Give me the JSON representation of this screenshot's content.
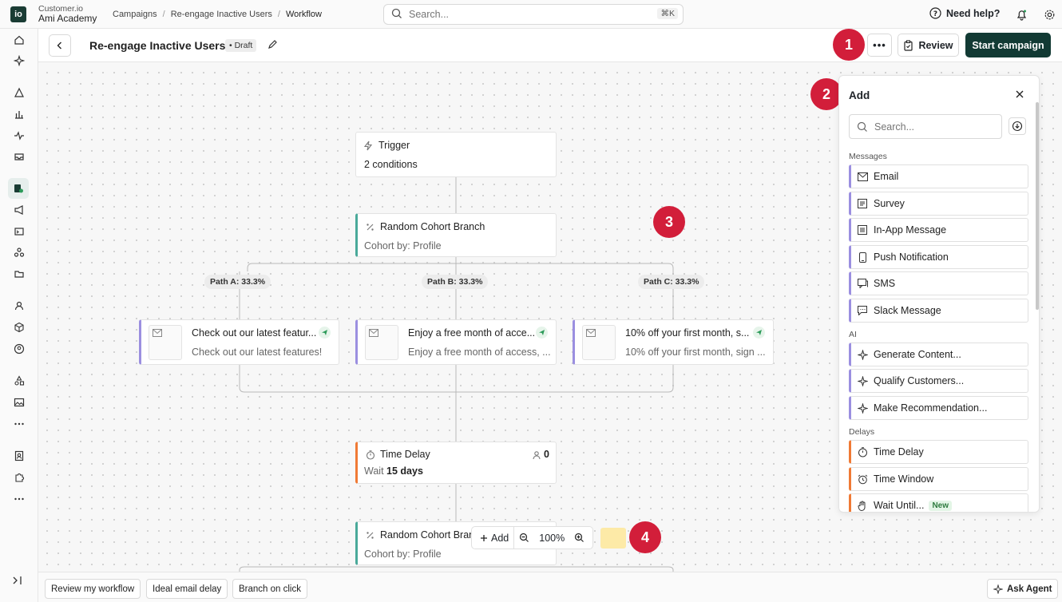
{
  "app": {
    "logo": "io",
    "org_line1": "Customer.io",
    "org_line2": "Ami Academy"
  },
  "breadcrumb": [
    "Campaigns",
    "Re-engage Inactive Users",
    "Workflow"
  ],
  "search": {
    "placeholder": "Search...",
    "shortcut": "⌘K"
  },
  "help": {
    "label": "Need help?"
  },
  "header": {
    "title": "Re-engage Inactive Users",
    "status": "Draft",
    "more": "•••",
    "review": "Review",
    "start": "Start campaign"
  },
  "badges": [
    "1",
    "2",
    "3",
    "4"
  ],
  "workflow": {
    "trigger": {
      "title": "Trigger",
      "sub": "2 conditions"
    },
    "branch1": {
      "title": "Random Cohort Branch",
      "sub": "Cohort by: Profile"
    },
    "paths": [
      "Path A: 33.3%",
      "Path B: 33.3%",
      "Path C: 33.3%"
    ],
    "emails": [
      {
        "title": "Check out our latest featur...",
        "sub": "Check out our latest features!"
      },
      {
        "title": "Enjoy a free month of acce...",
        "sub": "Enjoy a free month of access, ..."
      },
      {
        "title": "10% off your first month, s...",
        "sub": "10% off your first month, sign ..."
      }
    ],
    "delay": {
      "title": "Time Delay",
      "count": "0",
      "sub_prefix": "Wait",
      "sub_value": "15 days"
    },
    "branch2": {
      "title": "Random Cohort Bran",
      "sub": "Cohort by: Profile"
    }
  },
  "zoom": {
    "add": "Add",
    "level": "100%"
  },
  "panel": {
    "title": "Add",
    "search_placeholder": "Search...",
    "sections": {
      "messages": "Messages",
      "ai": "AI",
      "delays": "Delays"
    },
    "messages": [
      {
        "label": "Email",
        "icon": "mail-icon"
      },
      {
        "label": "Survey",
        "icon": "survey-icon"
      },
      {
        "label": "In-App Message",
        "icon": "inapp-icon"
      },
      {
        "label": "Push Notification",
        "icon": "phone-icon"
      },
      {
        "label": "SMS",
        "icon": "sms-icon"
      },
      {
        "label": "Slack Message",
        "icon": "slack-icon"
      }
    ],
    "ai": [
      {
        "label": "Generate Content...",
        "icon": "sparkle-icon"
      },
      {
        "label": "Qualify Customers...",
        "icon": "sparkle-icon"
      },
      {
        "label": "Make Recommendation...",
        "icon": "sparkle-icon"
      }
    ],
    "delays": [
      {
        "label": "Time Delay",
        "icon": "timer-icon"
      },
      {
        "label": "Time Window",
        "icon": "alarm-icon"
      },
      {
        "label": "Wait Until...",
        "icon": "hand-icon",
        "badge": "New"
      }
    ]
  },
  "bottom": {
    "chips": [
      "Review my workflow",
      "Ideal email delay",
      "Branch on click"
    ],
    "agent": "Ask Agent"
  },
  "colors": {
    "brand": "#123a34",
    "badge": "#d21e3a",
    "teal": "#4aa99a",
    "purple": "#9b8fe0",
    "orange": "#f07a35"
  }
}
